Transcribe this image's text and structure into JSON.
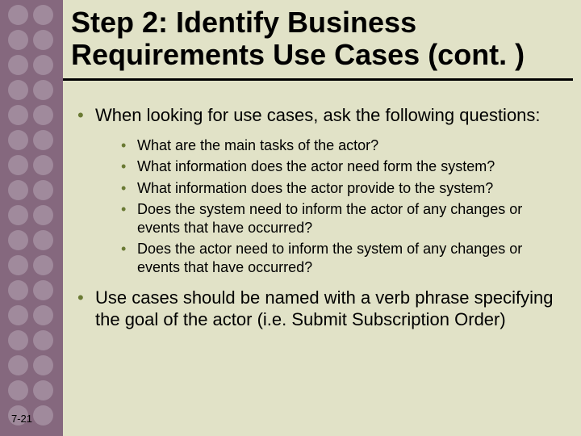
{
  "title": "Step 2: Identify Business Requirements Use Cases (cont. )",
  "bullets": {
    "b1": "When looking for use cases, ask the following questions:",
    "sub": {
      "s1": "What are the main tasks of the actor?",
      "s2": "What information does the actor need form the system?",
      "s3": "What information does the actor provide to the system?",
      "s4": "Does the system need to inform the actor of any changes or events that have occurred?",
      "s5": "Does the actor need to inform the system of any changes or events that have occurred?"
    },
    "b2": "Use cases should be named with a verb phrase specifying the goal of the actor (i.e. Submit Subscription Order)"
  },
  "page_number": "7-21"
}
